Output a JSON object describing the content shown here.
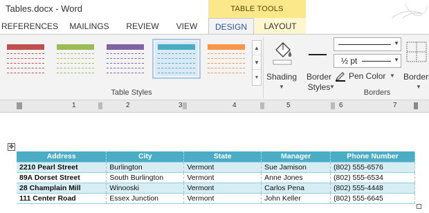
{
  "window": {
    "title": "Tables.docx - Word",
    "context_group": "TABLE TOOLS"
  },
  "tabs": [
    {
      "label": "REFERENCES"
    },
    {
      "label": "MAILINGS"
    },
    {
      "label": "REVIEW"
    },
    {
      "label": "VIEW"
    },
    {
      "label": "DESIGN",
      "active": true
    },
    {
      "label": "LAYOUT"
    }
  ],
  "ribbon": {
    "table_styles_label": "Table Styles",
    "shading_label": "Shading",
    "border_styles_label_1": "Border",
    "border_styles_label_2": "Styles",
    "pen_weight": "½ pt",
    "pen_color_label": "Pen Color",
    "borders_label": "Borders",
    "borders_group_label": "Borders",
    "style_colors": [
      "#c0504d",
      "#9bbb59",
      "#8064a2",
      "#4bacc6",
      "#f79646"
    ]
  },
  "ruler": {
    "numbers": [
      "1",
      "2",
      "3",
      "4",
      "5",
      "6",
      "7"
    ]
  },
  "table": {
    "headers": [
      "Address",
      "City",
      "State",
      "Manager",
      "Phone Number"
    ],
    "rows": [
      [
        "2210 Pearl Street",
        "Burlington",
        "Vermont",
        "Sue Jamison",
        "(802) 555-6576"
      ],
      [
        "89A Dorset Street",
        "South Burlington",
        "Vermont",
        "Anne Jones",
        "(802) 555-6534"
      ],
      [
        "28 Champlain Mill",
        "Winooski",
        "Vermont",
        "Carlos Pena",
        "(802) 555-4448"
      ],
      [
        "111 Center Road",
        "Essex Junction",
        "Vermont",
        "John Keller",
        "(802) 555-6645"
      ]
    ]
  },
  "colors": {
    "header_fill": "#4bacc6",
    "band_fill": "#d6edf4",
    "context_tab": "#fbe88a",
    "active_tab_text": "#2b579a"
  }
}
